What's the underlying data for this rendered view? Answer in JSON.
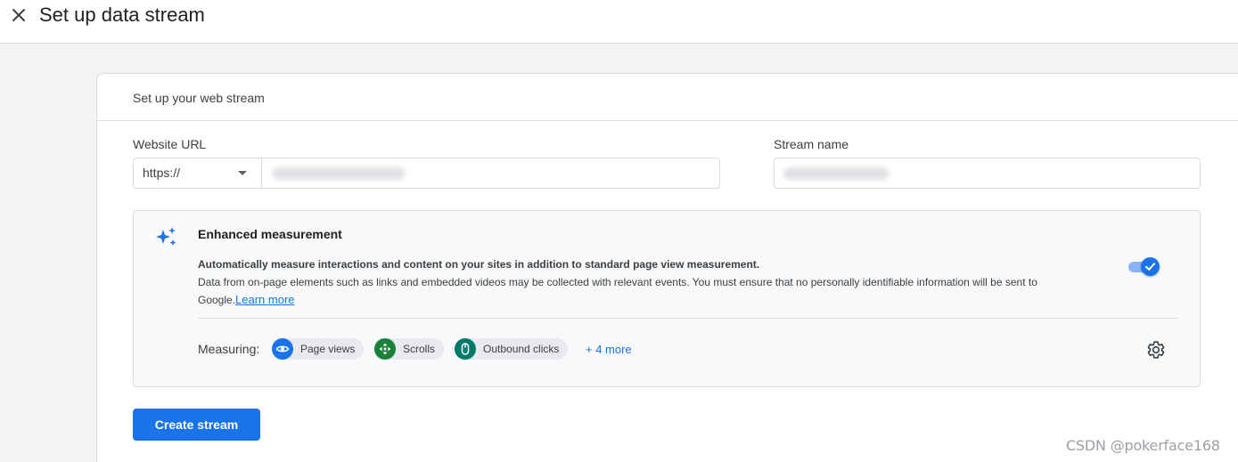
{
  "header": {
    "close_icon": "close-icon",
    "title": "Set up data stream"
  },
  "card": {
    "title": "Set up your web stream",
    "website_url": {
      "label": "Website URL",
      "protocol": "https://",
      "value": ""
    },
    "stream_name": {
      "label": "Stream name",
      "value": ""
    },
    "enhanced_measurement": {
      "icon": "sparkle-icon",
      "title": "Enhanced measurement",
      "lead": "Automatically measure interactions and content on your sites in addition to standard page view measurement.",
      "description": "Data from on-page elements such as links and embedded videos may be collected with relevant events. You must ensure that no personally identifiable information will be sent to Google.",
      "learn_more": "Learn more",
      "enabled": true,
      "measuring_label": "Measuring:",
      "chips": [
        {
          "label": "Page views",
          "icon": "eye-icon",
          "color": "#1a73e8"
        },
        {
          "label": "Scrolls",
          "icon": "scroll-arrows-icon",
          "color": "#188038"
        },
        {
          "label": "Outbound clicks",
          "icon": "mouse-icon",
          "color": "#00796b"
        }
      ],
      "more": "+ 4 more",
      "settings_icon": "gear-icon"
    },
    "create_button": "Create stream"
  },
  "watermark": "CSDN @pokerface168",
  "colors": {
    "accent": "#1a73e8",
    "toggle_track": "#8ab4f8",
    "panel_bg": "#f8f9fa",
    "page_bg": "#f1f3f4"
  }
}
